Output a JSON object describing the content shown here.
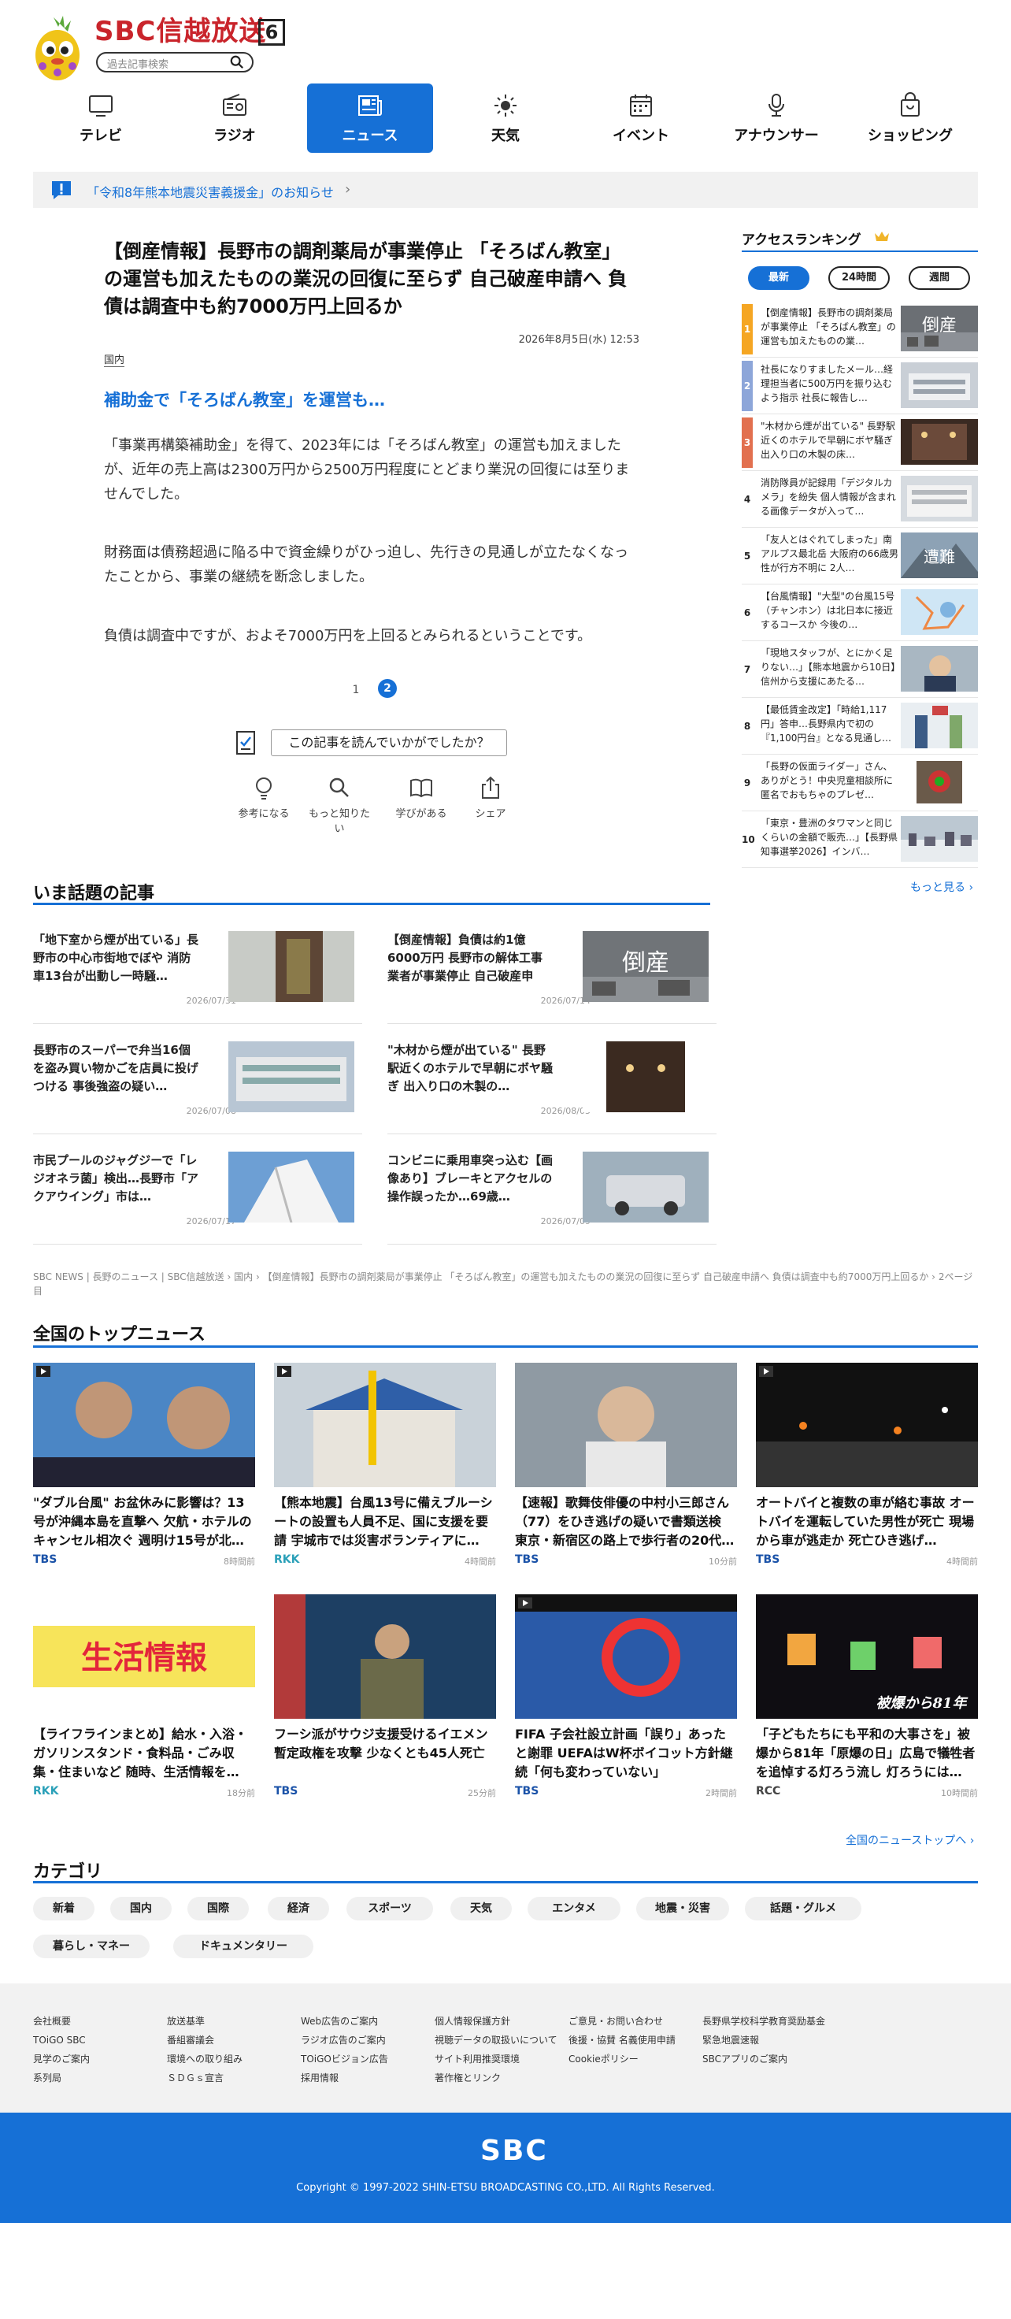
{
  "header": {
    "brand": "SBC信越放送",
    "channel": "6",
    "search_placeholder": "過去記事検索"
  },
  "nav": [
    {
      "label": "テレビ",
      "icon": "tv-icon"
    },
    {
      "label": "ラジオ",
      "icon": "radio-icon"
    },
    {
      "label": "ニュース",
      "icon": "news-icon"
    },
    {
      "label": "天気",
      "icon": "sun-icon"
    },
    {
      "label": "イベント",
      "icon": "calendar-icon"
    },
    {
      "label": "アナウンサー",
      "icon": "microphone-icon"
    },
    {
      "label": "ショッピング",
      "icon": "shopping-bag-icon"
    }
  ],
  "notice": {
    "text": "「令和8年熊本地震災害義援金」のお知らせ",
    "arrow": "›"
  },
  "article": {
    "title": "【倒産情報】長野市の調剤薬局が事業停止 「そろばん教室」の運営も加えたものの業況の回復に至らず 自己破産申請へ 負債は調査中も約7000万円上回るか",
    "date": "2026年8月5日(水) 12:53",
    "category": "国内",
    "subtitle": "補助金で「そろばん教室」を運営も…",
    "paragraphs": [
      "「事業再構築補助金」を得て、2023年には「そろばん教室」の運営も加えましたが、近年の売上高は2300万円から2500万円程度にとどまり業況の回復には至りませんでした。",
      "財務面は債務超過に陥る中で資金繰りがひっ迫し、先行きの見通しが立たなくなったことから、事業の継続を断念しました。",
      "負債は調査中ですが、およそ7000万円を上回るとみられるということです。"
    ],
    "pages": [
      "1",
      "2"
    ],
    "feedback": "この記事を読んでいかがでしたか？",
    "reactions": [
      "参考になる",
      "もっと知りたい",
      "学びがある",
      "シェア"
    ]
  },
  "ranking": {
    "title": "アクセスランキング",
    "tabs": [
      "最新",
      "24時間",
      "週間"
    ],
    "items": [
      {
        "rank": "1",
        "text": "【倒産情報】長野市の調剤薬局が事業停止 「そろばん教室」の運営も加えたものの業…",
        "thumb": "倒産"
      },
      {
        "rank": "2",
        "text": "社長になりすましたメール…経理担当者に500万円を振り込むよう指示 社長に報告し…",
        "thumb": ""
      },
      {
        "rank": "3",
        "text": "\"木材から煙が出ている\" 長野駅近くのホテルで早朝にボヤ騒ぎ 出入り口の木製の床…",
        "thumb": ""
      },
      {
        "rank": "4",
        "text": "消防隊員が記録用「デジタルカメラ」を紛失 個人情報が含まれる画像データが入って…",
        "thumb": ""
      },
      {
        "rank": "5",
        "text": "「友人とはぐれてしまった」南アルプス最北岳 大阪府の66歳男性が行方不明に 2人…",
        "thumb": "遭難"
      },
      {
        "rank": "6",
        "text": "【台風情報】\"大型\"の台風15号（チャンホン）は北日本に接近するコースか 今後の…",
        "thumb": ""
      },
      {
        "rank": "7",
        "text": "「現地スタッフが、とにかく足りない…」【熊本地震から10日】信州から支援にあたる…",
        "thumb": ""
      },
      {
        "rank": "8",
        "text": "【最低賃金改定】「時給1,117円」答申…長野県内で初の『1,100円台』となる見通し…",
        "thumb": ""
      },
      {
        "rank": "9",
        "text": "「長野の仮面ライダー」さん、ありがとう！中央児童相談所に匿名でおもちゃのプレゼ…",
        "thumb": ""
      },
      {
        "rank": "10",
        "text": "「東京・豊洲のタワマンと同じくらいの金額で販売…」【長野県知事選挙2026】インバ…",
        "thumb": ""
      }
    ],
    "more": "もっと見る ›"
  },
  "topics": {
    "title": "いま話題の記事",
    "items": [
      {
        "title": "「地下室から煙が出ている」長野市の中心市街地でぼや 消防車13台が出動し一時騒…",
        "date": "2026/07/31"
      },
      {
        "title": "【倒産情報】負債は約1億6000万円 長野市の解体工事業者が事業停止 自己破産申請…",
        "date": "2026/07/14",
        "thumb": "倒産"
      },
      {
        "title": "長野市のスーパーで弁当16個を盗み買い物かごを店員に投げつける 事後強盗の疑い…",
        "date": "2026/07/08"
      },
      {
        "title": "\"木材から煙が出ている\" 長野駅近くのホテルで早朝にボヤ騒ぎ 出入り口の木製の…",
        "date": "2026/08/05"
      },
      {
        "title": "市民プールのジャグジーで「レジオネラ菌」検出…長野市「アクアウイング」市は…",
        "date": "2026/07/17"
      },
      {
        "title": "コンビニに乗用車突っ込む【画像あり】ブレーキとアクセルの操作誤ったか…69歳…",
        "date": "2026/07/09"
      }
    ]
  },
  "breadcrumb": [
    "SBC NEWS | 長野のニュース | SBC信越放送",
    "›",
    "国内",
    "›",
    "【倒産情報】長野市の調剤薬局が事業停止 「そろばん教室」の運営も加えたものの業況の回復に至らず 自己破産申請へ 負債は調査中も約7000万円上回るか",
    "›",
    "2ページ目"
  ],
  "national": {
    "title": "全国のトップニュース",
    "items": [
      {
        "title": "\"ダブル台風\" お盆休みに影響は？13号が沖縄本島を直撃へ 欠航・ホテルのキャンセル相次ぐ 週明け15号が北…",
        "source": "TBS",
        "time": "8時間前",
        "video": true
      },
      {
        "title": "【熊本地震】台風13号に備えブルーシートの設置も人員不足、国に支援を要請 宇城市では災害ボランティアに…",
        "source": "RKK",
        "time": "4時間前",
        "video": true
      },
      {
        "title": "【速報】歌舞伎俳優の中村小三郎さん（77）をひき逃げの疑いで書類送検 東京・新宿区の路上で歩行者の20代…",
        "source": "TBS",
        "time": "10分前",
        "video": false
      },
      {
        "title": "オートバイと複数の車が絡む事故 オートバイを運転していた男性が死亡 現場から車が逃走か 死亡ひき逃げ…",
        "source": "TBS",
        "time": "4時間前",
        "video": true
      },
      {
        "title": "【ライフラインまとめ】給水・入浴・ガソリンスタンド・食料品・ごみ収集・住まいなど 随時、生活情報を…",
        "source": "RKK",
        "time": "18分前",
        "video": false,
        "thumb": "生活情報"
      },
      {
        "title": "フーシ派がサウジ支援受けるイエメン暫定政権を攻撃 少なくとも45人死亡",
        "source": "TBS",
        "time": "25分前",
        "video": false
      },
      {
        "title": "FIFA 子会社設立計画「誤り」あったと謝罪 UEFAはW杯ボイコット方針継続「何も変わっていない」",
        "source": "TBS",
        "time": "2時間前",
        "video": true
      },
      {
        "title": "「子どもたちにも平和の大事さを」被爆から81年「原爆の日」広島で犠牲者を追悼する灯ろう流し 灯ろうには…",
        "source": "RCC",
        "time": "10時間前",
        "video": false,
        "thumb": "被爆から81年"
      }
    ],
    "more": "全国のニューストップへ ›"
  },
  "categories": {
    "title": "カテゴリ",
    "items": [
      "新着",
      "国内",
      "国際",
      "経済",
      "スポーツ",
      "天気",
      "エンタメ",
      "地震・災害",
      "話題・グルメ",
      "暮らし・マネー",
      "ドキュメンタリー"
    ]
  },
  "footer": {
    "cols": [
      [
        "会社概要",
        "TOiGO SBC",
        "見学のご案内",
        "系列局"
      ],
      [
        "放送基準",
        "番組審議会",
        "環境への取り組み",
        "ＳＤＧｓ宣言"
      ],
      [
        "Web広告のご案内",
        "ラジオ広告のご案内",
        "TOiGOビジョン広告",
        "採用情報"
      ],
      [
        "個人情報保護方針",
        "視聴データの取扱いについて",
        "サイト利用推奨環境",
        "著作権とリンク"
      ],
      [
        "ご意見・お問い合わせ",
        "後援・協賛 名義使用申請",
        "Cookieポリシー"
      ],
      [
        "長野県学校科学教育奨励基金",
        "緊急地震速報",
        "SBCアプリのご案内"
      ]
    ],
    "logo": "SBC",
    "copyright": "Copyright © 1997-2022 SHIN-ETSU BROADCASTING CO.,LTD. All Rights Reserved."
  },
  "colors": {
    "accent": "#1670d6",
    "rank1": "#f5a623",
    "rank2": "#8da6d9",
    "rank3": "#e2704f"
  }
}
